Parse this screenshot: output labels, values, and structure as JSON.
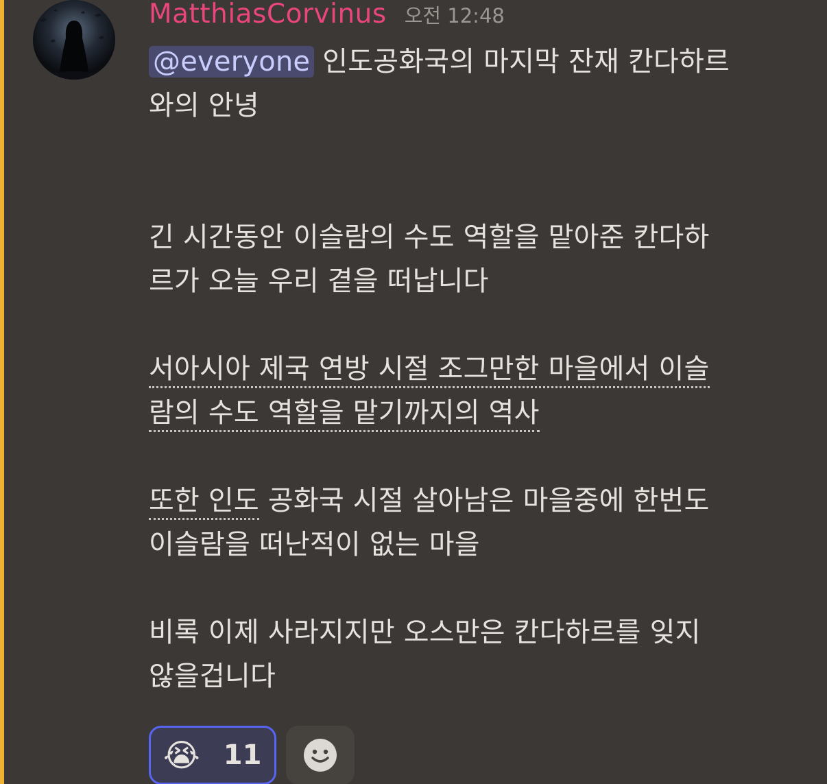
{
  "message": {
    "username": "MatthiasCorvinus",
    "timestamp": "오전 12:48",
    "mention": "@everyone",
    "headline": "인도공화국의 마지막 잔재 칸다하르\n와의 안녕",
    "paragraph1": "긴 시간동안 이슬람의 수도 역할을 맡아준 칸다하\n르가 오늘 우리 곁을 떠납니다",
    "paragraph2_line1": "서아시아 제국 연방 시절 조그만한 마을에서 이슬",
    "paragraph2_line2": "람의 수도 역할을 맡기까지의 역사",
    "paragraph3_link": "또한 인도",
    "paragraph3_rest": " 공화국 시절 살아남은 마을중에 한번도\n이슬람을 떠난적이 없는 마을",
    "paragraph4": "비록 이제 사라지지만 오스만은 칸다하르를 잊지\n않을겁니다"
  },
  "reactions": [
    {
      "emoji": "😭",
      "emoji_name": "loudly-crying-face-icon",
      "count": "11"
    }
  ],
  "colors": {
    "background": "#3b3835",
    "username": "#e8467c",
    "mention_bar": "#f0b232",
    "mention_bg": "#4a4a6e",
    "reaction_border": "#5865f2"
  },
  "icons": {
    "add_reaction": "smiley-face-icon"
  }
}
